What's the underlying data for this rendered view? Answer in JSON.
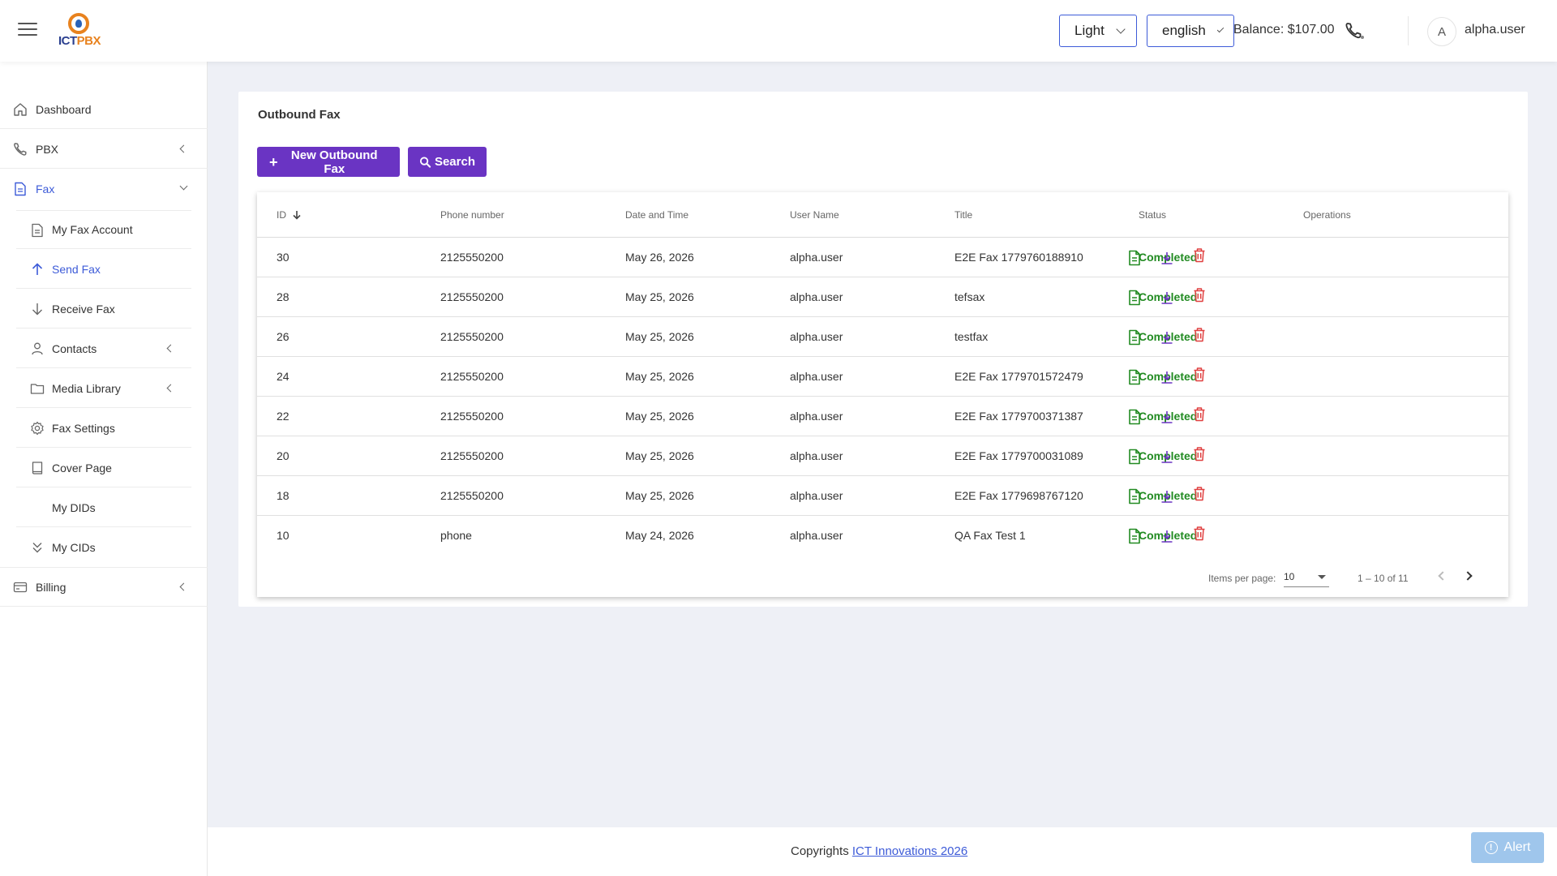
{
  "header": {
    "theme_select": "Light",
    "language_select": "english",
    "balance": "Balance: $107.00",
    "avatar_initial": "A",
    "username": "alpha.user",
    "logo_text_a": "ICT",
    "logo_text_b": "PBX"
  },
  "sidebar": {
    "items": [
      {
        "label": "Dashboard",
        "icon": "home-icon"
      },
      {
        "label": "PBX",
        "icon": "phone-icon"
      },
      {
        "label": "Fax",
        "icon": "document-icon"
      },
      {
        "label": "Billing",
        "icon": "credit-card-icon"
      }
    ],
    "fax_sub": [
      {
        "label": "My Fax Account",
        "icon": "document-icon"
      },
      {
        "label": "Send Fax",
        "icon": "arrow-up-icon"
      },
      {
        "label": "Receive Fax",
        "icon": "arrow-down-icon"
      },
      {
        "label": "Contacts",
        "icon": "person-icon"
      },
      {
        "label": "Media Library",
        "icon": "folder-icon"
      },
      {
        "label": "Fax Settings",
        "icon": "gear-icon"
      },
      {
        "label": "Cover Page",
        "icon": "book-icon"
      },
      {
        "label": "My DIDs",
        "icon": ""
      },
      {
        "label": "My CIDs",
        "icon": "double-chevron-down-icon"
      }
    ]
  },
  "main": {
    "title": "Outbound Fax",
    "new_button": "New Outbound Fax",
    "search_button": "Search",
    "columns": {
      "id": "ID",
      "phone": "Phone number",
      "date": "Date and Time",
      "user": "User Name",
      "title": "Title",
      "status": "Status",
      "ops": "Operations"
    },
    "rows": [
      {
        "id": "30",
        "phone": "2125550200",
        "date": "May 26, 2026",
        "user": "alpha.user",
        "title": "E2E Fax 1779760188910",
        "status": "Completed"
      },
      {
        "id": "28",
        "phone": "2125550200",
        "date": "May 25, 2026",
        "user": "alpha.user",
        "title": "tefsax",
        "status": "Completed"
      },
      {
        "id": "26",
        "phone": "2125550200",
        "date": "May 25, 2026",
        "user": "alpha.user",
        "title": "testfax",
        "status": "Completed"
      },
      {
        "id": "24",
        "phone": "2125550200",
        "date": "May 25, 2026",
        "user": "alpha.user",
        "title": "E2E Fax 1779701572479",
        "status": "Completed"
      },
      {
        "id": "22",
        "phone": "2125550200",
        "date": "May 25, 2026",
        "user": "alpha.user",
        "title": "E2E Fax 1779700371387",
        "status": "Completed"
      },
      {
        "id": "20",
        "phone": "2125550200",
        "date": "May 25, 2026",
        "user": "alpha.user",
        "title": "E2E Fax 1779700031089",
        "status": "Completed"
      },
      {
        "id": "18",
        "phone": "2125550200",
        "date": "May 25, 2026",
        "user": "alpha.user",
        "title": "E2E Fax 1779698767120",
        "status": "Completed"
      },
      {
        "id": "10",
        "phone": "phone",
        "date": "May 24, 2026",
        "user": "alpha.user",
        "title": "QA Fax Test 1",
        "status": "Completed"
      }
    ],
    "pager": {
      "items_per_page_label": "Items per page:",
      "items_per_page": "10",
      "range": "1 – 10 of 11"
    }
  },
  "footer": {
    "copyright_prefix": "Copyrights",
    "copyright_link": "ICT Innovations 2026",
    "alert": "Alert"
  },
  "colors": {
    "primary": "#6a34c3",
    "accent": "#3d5bd8",
    "status_completed": "#228b22",
    "delete": "#e04040"
  }
}
